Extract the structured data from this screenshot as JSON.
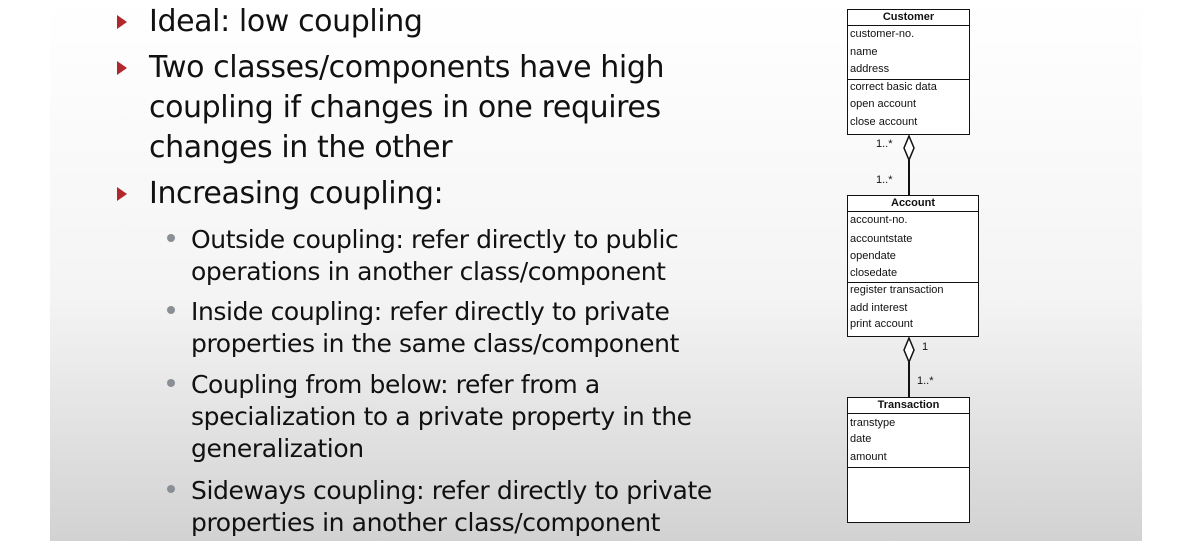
{
  "bullets": [
    {
      "text": "Ideal: low coupling"
    },
    {
      "text": "Two classes/components have high coupling if changes in one requires changes in the other"
    },
    {
      "text": "Increasing coupling:",
      "sub": [
        "Outside coupling: refer directly to public operations in another class/component",
        "Inside coupling: refer directly to private properties in the same class/component",
        "Coupling from below: refer from a specialization to a private property in the generalization",
        "Sideways coupling: refer directly to private properties in another class/component"
      ]
    }
  ],
  "uml": {
    "customer": {
      "name": "Customer",
      "attributes": [
        "customer-no.",
        "name",
        "address"
      ],
      "operations": [
        "correct basic data",
        "open account",
        "close account"
      ]
    },
    "account": {
      "name": "Account",
      "attributes": [
        "account-no.",
        "accountstate",
        "opendate",
        "closedate"
      ],
      "operations": [
        "register transaction",
        "add interest",
        "print  account"
      ]
    },
    "transaction": {
      "name": "Transaction",
      "attributes": [
        "transtype",
        "date",
        "amount"
      ],
      "operations": []
    },
    "multiplicities": {
      "customer_end": "1..*",
      "account_top": "1..*",
      "account_bottom": "1",
      "transaction_top": "1..*"
    }
  },
  "colors": {
    "bullet_arrow": "#b0272d",
    "sub_dot": "#8a8f95"
  }
}
